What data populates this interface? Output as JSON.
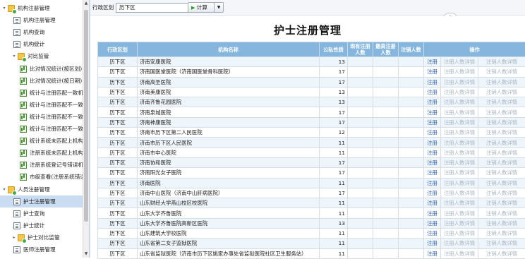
{
  "sidebar": {
    "items": [
      {
        "label": "机构注册管理",
        "level": 0,
        "icon": "folder-icon",
        "toggle": "▾"
      },
      {
        "label": "机构注册管理",
        "level": 1,
        "icon": "document-icon"
      },
      {
        "label": "机构查询",
        "level": 1,
        "icon": "document-icon"
      },
      {
        "label": "机构统计",
        "level": 1,
        "icon": "document-icon"
      },
      {
        "label": "对比监管",
        "level": 1,
        "icon": "folder-icon",
        "toggle": "▾"
      },
      {
        "label": "比对情况统计(按区划)",
        "level": 2,
        "icon": "chart-icon"
      },
      {
        "label": "比对情况统计(按日期)",
        "level": 2,
        "icon": "chart-icon"
      },
      {
        "label": "统计与注册匹配一致机",
        "level": 2,
        "icon": "chart-icon"
      },
      {
        "label": "统计与注册匹配不一致",
        "level": 2,
        "icon": "chart-icon"
      },
      {
        "label": "统计与注册匹配不一致",
        "level": 2,
        "icon": "chart-icon"
      },
      {
        "label": "统计与注册匹配不一致",
        "level": 2,
        "icon": "chart-icon"
      },
      {
        "label": "统计系统未匹配上机构",
        "level": 2,
        "icon": "chart-icon"
      },
      {
        "label": "注册系统未匹配上机构",
        "level": 2,
        "icon": "chart-icon"
      },
      {
        "label": "注册系统登记号错误机",
        "level": 2,
        "icon": "chart-icon"
      },
      {
        "label": "市级查看(注册系统错误",
        "level": 2,
        "icon": "chart-icon"
      },
      {
        "label": "人员注册管理",
        "level": 0,
        "icon": "folder-icon",
        "toggle": "▾"
      },
      {
        "label": "护士注册管理",
        "level": 1,
        "icon": "document-icon",
        "selected": true
      },
      {
        "label": "护士查询",
        "level": 1,
        "icon": "document-icon"
      },
      {
        "label": "护士统计",
        "level": 1,
        "icon": "document-icon"
      },
      {
        "label": "护士对比监管",
        "level": 1,
        "icon": "folder-icon",
        "toggle": "▸"
      },
      {
        "label": "医师注册管理",
        "level": 1,
        "icon": "document-icon"
      }
    ]
  },
  "toolbar": {
    "district_label": "行政区划",
    "district_value": "历下区",
    "calc_label": "计算",
    "play_icon": "play-icon"
  },
  "report": {
    "title": "护士注册管理",
    "columns": [
      "行政区划",
      "机构名称",
      "公私性质",
      "现有注册\n人数",
      "最高注册\n人数",
      "注销人数",
      "操作"
    ],
    "actions": [
      "注册",
      "注册人数详情",
      "注销人数详情"
    ],
    "rows": [
      {
        "district": "历下区",
        "name": "济南安康医院",
        "nature": "13"
      },
      {
        "district": "历下区",
        "name": "济南国医堂医院（济南国医堂骨科医院）",
        "nature": "17"
      },
      {
        "district": "历下区",
        "name": "济南高圣医院",
        "nature": "17"
      },
      {
        "district": "历下区",
        "name": "济南美康医院",
        "nature": "13"
      },
      {
        "district": "历下区",
        "name": "济南齐鲁花园医院",
        "nature": "13"
      },
      {
        "district": "历下区",
        "name": "济南泉城医院",
        "nature": "17"
      },
      {
        "district": "历下区",
        "name": "济南神康医院",
        "nature": "17"
      },
      {
        "district": "历下区",
        "name": "济南市历下区第二人民医院",
        "nature": "12"
      },
      {
        "district": "历下区",
        "name": "济南市历下区人民医院",
        "nature": "11"
      },
      {
        "district": "历下区",
        "name": "济南市中心医院",
        "nature": "11"
      },
      {
        "district": "历下区",
        "name": "济南协和医院",
        "nature": "17"
      },
      {
        "district": "历下区",
        "name": "济南阳光女子医院",
        "nature": "17"
      },
      {
        "district": "历下区",
        "name": "济南医院",
        "nature": "11"
      },
      {
        "district": "历下区",
        "name": "济南中山医院（济南中山肝病医院）",
        "nature": "17"
      },
      {
        "district": "历下区",
        "name": "山东财经大学燕山校区校医院",
        "nature": "11"
      },
      {
        "district": "历下区",
        "name": "山东大学齐鲁医院",
        "nature": "11"
      },
      {
        "district": "历下区",
        "name": "山东大学齐鲁医院高新区医院",
        "nature": "13"
      },
      {
        "district": "历下区",
        "name": "山东建筑大学校医院",
        "nature": "11"
      },
      {
        "district": "历下区",
        "name": "山东省第二女子监狱医院",
        "nature": "11"
      },
      {
        "district": "历下区",
        "name": "山东省监狱医院（济南市历下区姚家办事处省监狱医院社区卫生服务站）",
        "nature": "11"
      }
    ]
  },
  "colors": {
    "header_bg": "#86b6dd",
    "selected_bg": "#c9dcf2",
    "link": "#2b5ea8",
    "link_disabled": "#a8b4c2"
  }
}
